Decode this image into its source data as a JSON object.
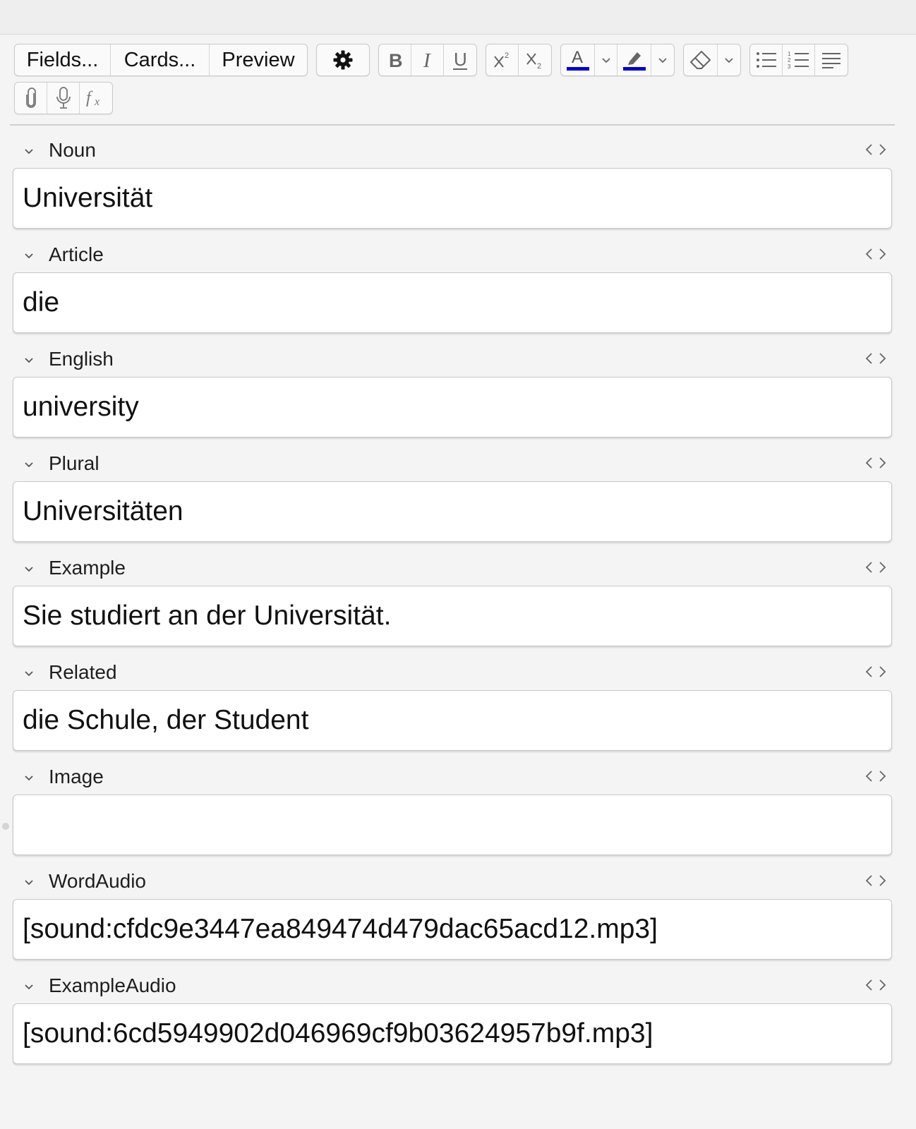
{
  "toolbar": {
    "fields_label": "Fields...",
    "cards_label": "Cards...",
    "preview_label": "Preview"
  },
  "fields": [
    {
      "label": "Noun",
      "value": "Universität"
    },
    {
      "label": "Article",
      "value": "die"
    },
    {
      "label": "English",
      "value": "university"
    },
    {
      "label": "Plural",
      "value": "Universitäten"
    },
    {
      "label": "Example",
      "value": "Sie studiert an der Universität."
    },
    {
      "label": "Related",
      "value": "die Schule, der Student"
    },
    {
      "label": "Image",
      "value": ""
    },
    {
      "label": "WordAudio",
      "value": "[sound:cfdc9e3447ea849474d479dac65acd12.mp3]"
    },
    {
      "label": "ExampleAudio",
      "value": "[sound:6cd5949902d046969cf9b03624957b9f.mp3]"
    }
  ],
  "colors": {
    "text_color_swatch": "#0000d6",
    "highlight_color_swatch": "#0000d6"
  },
  "icons": {
    "options": "gear-icon",
    "bold": "bold-icon",
    "italic": "italic-icon",
    "underline": "underline-icon",
    "superscript": "superscript-icon",
    "subscript": "subscript-icon",
    "text_color": "text-color-icon",
    "highlight": "highlighter-icon",
    "clear_format": "eraser-icon",
    "unordered_list": "bullet-list-icon",
    "ordered_list": "numbered-list-icon",
    "align": "align-icon",
    "attach": "paperclip-icon",
    "record": "microphone-icon",
    "math": "function-icon"
  }
}
